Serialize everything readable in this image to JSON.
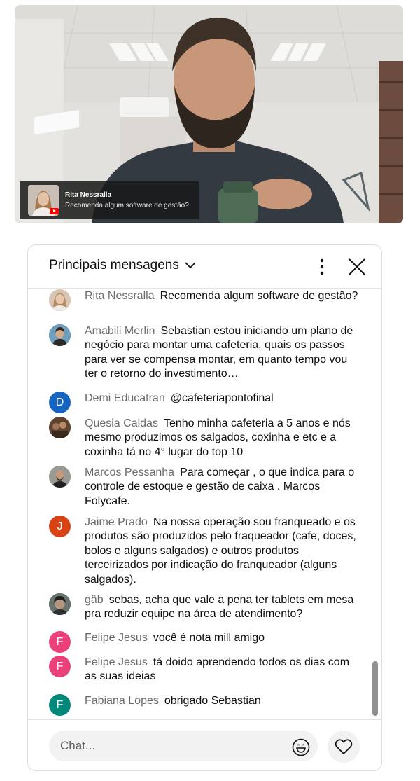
{
  "overlay": {
    "author": "Rita Nessralla",
    "message": "Recomenda algum software de gestão?"
  },
  "chat": {
    "title": "Principais mensagens",
    "messages": [
      {
        "author": "Rita Nessralla",
        "text": "Recomenda algum software de gestão?",
        "avatar": "photo",
        "color": "#d8c4b2"
      },
      {
        "author": "Amabili Merlin",
        "text": "Sebastian estou iniciando um plano de negócio para montar uma cafeteria, quais os passos para ver se compensa montar, em quanto tempo vou ter o retorno do investimento…",
        "avatar": "photo",
        "color": "#5b8fb0"
      },
      {
        "author": "Demi Educatran",
        "text": "@cafeteriapontofinal",
        "avatar": "D",
        "color": "#1565c0"
      },
      {
        "author": "Quesia Caldas",
        "text": "Tenho minha cafeteria a 5 anos e nós mesmo produzimos os salgados, coxinha e etc e a coxinha tá no 4° lugar do top 10",
        "avatar": "photo",
        "color": "#6d4f3a"
      },
      {
        "author": "Marcos Pessanha",
        "text": "Para começar , o que indica para o controle de estoque e gestão de caixa . Marcos Folycafe.",
        "avatar": "photo",
        "color": "#8a8a84"
      },
      {
        "author": "Jaime Prado",
        "text": "Na nossa operação sou franqueado e os produtos são produzidos pelo fraqueador (cafe, doces, bolos e alguns salgados) e outros produtos terceirizados por indicação do franqueador (alguns salgados).",
        "avatar": "J",
        "color": "#d84315"
      },
      {
        "author": "gäb",
        "text": "sebas, acha que vale a pena ter tablets em mesa pra reduzir equipe na área de atendimento?",
        "avatar": "photo",
        "color": "#55605a"
      },
      {
        "author": "Felipe Jesus",
        "text": "você é nota mill amigo",
        "avatar": "F",
        "color": "#ec407a"
      },
      {
        "author": "Felipe Jesus",
        "text": "tá doido aprendendo todos os dias com as suas ideias",
        "avatar": "F",
        "color": "#ec407a"
      },
      {
        "author": "Fabiana Lopes",
        "text": "obrigado Sebastian",
        "avatar": "F",
        "color": "#00897b"
      }
    ],
    "input_placeholder": "Chat..."
  },
  "icons": {
    "dropdown": "chevron-down-icon",
    "more": "more-vert-icon",
    "close": "close-icon",
    "emoji": "emoji-icon",
    "like": "heart-icon"
  }
}
